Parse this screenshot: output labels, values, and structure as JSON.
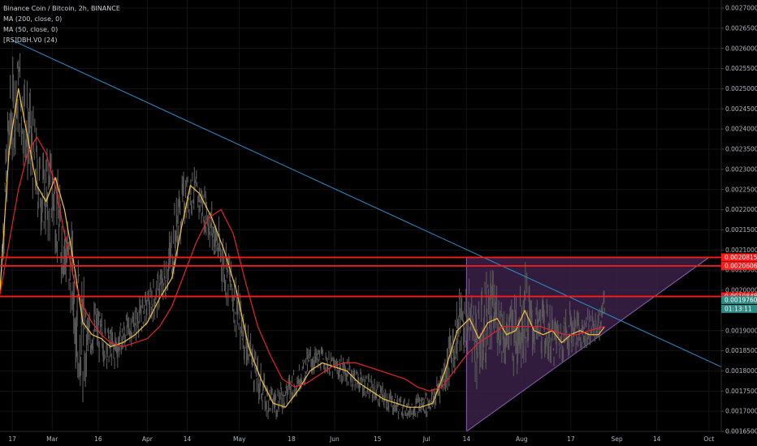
{
  "legend": {
    "line1": "Binance Coin / Bitcoin, 2h, BINANCE",
    "line2": "MA (200, close, 0)",
    "line3": "MA (50, close, 0)",
    "line4": "[RS]DBH.V0 (24)"
  },
  "colors": {
    "background": "#000000",
    "grid": "#141414",
    "candle": "#5a5a5a",
    "ma50": "#f5c23a",
    "ma200": "#e5252b",
    "trendline": "#2f8fd0",
    "level": "#ff1a1a",
    "triangle_fill": "#3a2148",
    "triangle_edge": "#8a5fb0",
    "last_price": "#2e8a84"
  },
  "chart_data": {
    "type": "line",
    "title": "Binance Coin / Bitcoin, 2h, BINANCE",
    "xlabel": "",
    "ylabel": "",
    "x_range": [
      "2020-02-13",
      "2020-10-05"
    ],
    "ylim": [
      0.00165,
      0.00272
    ],
    "y_ticks": [
      "0.0027000",
      "0.0026500",
      "0.0026000",
      "0.0025500",
      "0.0025000",
      "0.0024500",
      "0.0024000",
      "0.0023500",
      "0.0023000",
      "0.0022500",
      "0.0022000",
      "0.0021500",
      "0.0021000",
      "0.0020500",
      "0.0020000",
      "0.0019500",
      "0.0019000",
      "0.0018500",
      "0.0018000",
      "0.0017500",
      "0.0017000",
      "0.0016500"
    ],
    "x_ticks": [
      {
        "label": "17",
        "date": "2020-02-17"
      },
      {
        "label": "Mar",
        "date": "2020-03-01"
      },
      {
        "label": "16",
        "date": "2020-03-16"
      },
      {
        "label": "Apr",
        "date": "2020-04-01"
      },
      {
        "label": "14",
        "date": "2020-04-14"
      },
      {
        "label": "May",
        "date": "2020-05-01"
      },
      {
        "label": "18",
        "date": "2020-05-18"
      },
      {
        "label": "Jun",
        "date": "2020-06-01"
      },
      {
        "label": "15",
        "date": "2020-06-15"
      },
      {
        "label": "Jul",
        "date": "2020-07-01"
      },
      {
        "label": "14",
        "date": "2020-07-14"
      },
      {
        "label": "Aug",
        "date": "2020-08-01"
      },
      {
        "label": "17",
        "date": "2020-08-17"
      },
      {
        "label": "Sep",
        "date": "2020-09-01"
      },
      {
        "label": "14",
        "date": "2020-09-14"
      },
      {
        "label": "Oct",
        "date": "2020-10-01"
      }
    ],
    "price_range": {
      "dates": [
        "2020-02-13",
        "2020-02-16",
        "2020-02-19",
        "2020-02-21",
        "2020-02-24",
        "2020-02-27",
        "2020-03-01",
        "2020-03-04",
        "2020-03-07",
        "2020-03-09",
        "2020-03-11",
        "2020-03-13",
        "2020-03-15",
        "2020-03-18",
        "2020-03-21",
        "2020-03-24",
        "2020-03-27",
        "2020-03-31",
        "2020-04-04",
        "2020-04-07",
        "2020-04-10",
        "2020-04-13",
        "2020-04-16",
        "2020-04-20",
        "2020-04-24",
        "2020-04-28",
        "2020-05-01",
        "2020-05-04",
        "2020-05-07",
        "2020-05-10",
        "2020-05-13",
        "2020-05-16",
        "2020-05-20",
        "2020-05-24",
        "2020-05-28",
        "2020-06-01",
        "2020-06-05",
        "2020-06-09",
        "2020-06-13",
        "2020-06-17",
        "2020-06-21",
        "2020-06-25",
        "2020-06-29",
        "2020-07-03",
        "2020-07-07",
        "2020-07-11",
        "2020-07-15",
        "2020-07-18",
        "2020-07-21",
        "2020-07-24",
        "2020-07-27",
        "2020-07-30",
        "2020-08-02",
        "2020-08-05",
        "2020-08-08",
        "2020-08-11",
        "2020-08-14",
        "2020-08-17",
        "2020-08-20",
        "2020-08-23",
        "2020-08-26",
        "2020-08-28"
      ],
      "high": [
        0.00205,
        0.00256,
        0.00261,
        0.00258,
        0.00245,
        0.00234,
        0.00238,
        0.00225,
        0.00218,
        0.00212,
        0.00205,
        0.00195,
        0.00198,
        0.00194,
        0.00191,
        0.00194,
        0.00196,
        0.002,
        0.00204,
        0.0021,
        0.00223,
        0.0023,
        0.00231,
        0.00226,
        0.00219,
        0.00211,
        0.002,
        0.00193,
        0.00184,
        0.00178,
        0.00177,
        0.00179,
        0.00182,
        0.00187,
        0.00186,
        0.00184,
        0.00184,
        0.00181,
        0.00179,
        0.00177,
        0.00175,
        0.00173,
        0.00175,
        0.00176,
        0.00185,
        0.002,
        0.00203,
        0.00199,
        0.00207,
        0.00203,
        0.00196,
        0.00203,
        0.00208,
        0.00197,
        0.00199,
        0.00196,
        0.00194,
        0.00198,
        0.00194,
        0.00196,
        0.00195,
        0.00201
      ],
      "low": [
        0.00197,
        0.00224,
        0.00238,
        0.00228,
        0.0022,
        0.00211,
        0.00212,
        0.002,
        0.00193,
        0.00178,
        0.00168,
        0.00181,
        0.00183,
        0.00181,
        0.00179,
        0.00183,
        0.00186,
        0.0019,
        0.00193,
        0.00196,
        0.00204,
        0.00216,
        0.00219,
        0.00213,
        0.00203,
        0.00193,
        0.00186,
        0.00178,
        0.00172,
        0.00168,
        0.00168,
        0.0017,
        0.00174,
        0.00178,
        0.0018,
        0.00177,
        0.00176,
        0.00174,
        0.00172,
        0.0017,
        0.00168,
        0.00168,
        0.00168,
        0.00169,
        0.00174,
        0.0018,
        0.00184,
        0.00173,
        0.00181,
        0.00184,
        0.0018,
        0.00178,
        0.00182,
        0.00183,
        0.00183,
        0.00181,
        0.00182,
        0.00184,
        0.00185,
        0.00186,
        0.00187,
        0.0019
      ]
    },
    "series": [
      {
        "name": "MA (50, close, 0)",
        "dates": [
          "2020-02-13",
          "2020-02-16",
          "2020-02-19",
          "2020-02-22",
          "2020-02-25",
          "2020-02-28",
          "2020-03-02",
          "2020-03-05",
          "2020-03-08",
          "2020-03-11",
          "2020-03-14",
          "2020-03-17",
          "2020-03-20",
          "2020-03-24",
          "2020-03-28",
          "2020-04-01",
          "2020-04-05",
          "2020-04-09",
          "2020-04-12",
          "2020-04-15",
          "2020-04-18",
          "2020-04-22",
          "2020-04-26",
          "2020-04-30",
          "2020-05-04",
          "2020-05-08",
          "2020-05-12",
          "2020-05-16",
          "2020-05-20",
          "2020-05-24",
          "2020-05-28",
          "2020-06-01",
          "2020-06-05",
          "2020-06-09",
          "2020-06-13",
          "2020-06-17",
          "2020-06-21",
          "2020-06-25",
          "2020-06-29",
          "2020-07-03",
          "2020-07-07",
          "2020-07-11",
          "2020-07-15",
          "2020-07-18",
          "2020-07-21",
          "2020-07-24",
          "2020-07-27",
          "2020-07-30",
          "2020-08-02",
          "2020-08-05",
          "2020-08-08",
          "2020-08-11",
          "2020-08-14",
          "2020-08-17",
          "2020-08-20",
          "2020-08-23",
          "2020-08-26",
          "2020-08-28"
        ],
        "values": [
          0.002,
          0.00235,
          0.0025,
          0.00238,
          0.00226,
          0.00222,
          0.00228,
          0.0022,
          0.00207,
          0.00192,
          0.00189,
          0.00188,
          0.00186,
          0.00187,
          0.00189,
          0.00192,
          0.00198,
          0.00203,
          0.00215,
          0.00226,
          0.00224,
          0.00218,
          0.0021,
          0.002,
          0.00186,
          0.00178,
          0.00172,
          0.00171,
          0.00175,
          0.0018,
          0.00182,
          0.00181,
          0.0018,
          0.00177,
          0.00175,
          0.00173,
          0.00172,
          0.00171,
          0.00171,
          0.00172,
          0.0018,
          0.0019,
          0.00193,
          0.00188,
          0.00192,
          0.00193,
          0.00189,
          0.0019,
          0.00195,
          0.0019,
          0.00189,
          0.0019,
          0.00187,
          0.00189,
          0.0019,
          0.00189,
          0.00189,
          0.00191
        ]
      },
      {
        "name": "MA (200, close, 0)",
        "dates": [
          "2020-02-13",
          "2020-02-16",
          "2020-02-19",
          "2020-02-22",
          "2020-02-25",
          "2020-02-28",
          "2020-03-02",
          "2020-03-05",
          "2020-03-08",
          "2020-03-11",
          "2020-03-14",
          "2020-03-17",
          "2020-03-20",
          "2020-03-24",
          "2020-03-28",
          "2020-04-01",
          "2020-04-05",
          "2020-04-09",
          "2020-04-13",
          "2020-04-17",
          "2020-04-21",
          "2020-04-25",
          "2020-04-29",
          "2020-05-03",
          "2020-05-07",
          "2020-05-11",
          "2020-05-15",
          "2020-05-19",
          "2020-05-23",
          "2020-05-27",
          "2020-05-31",
          "2020-06-04",
          "2020-06-08",
          "2020-06-12",
          "2020-06-16",
          "2020-06-20",
          "2020-06-24",
          "2020-06-28",
          "2020-07-02",
          "2020-07-06",
          "2020-07-10",
          "2020-07-14",
          "2020-07-18",
          "2020-07-22",
          "2020-07-26",
          "2020-07-30",
          "2020-08-03",
          "2020-08-07",
          "2020-08-11",
          "2020-08-15",
          "2020-08-19",
          "2020-08-23",
          "2020-08-28"
        ],
        "values": [
          0.00199,
          0.00212,
          0.00225,
          0.00234,
          0.00238,
          0.00234,
          0.00226,
          0.00214,
          0.00203,
          0.00196,
          0.00192,
          0.00189,
          0.00187,
          0.00186,
          0.00187,
          0.00188,
          0.00191,
          0.00196,
          0.00204,
          0.00212,
          0.00218,
          0.0022,
          0.00214,
          0.00202,
          0.00191,
          0.00184,
          0.00178,
          0.00176,
          0.00177,
          0.00179,
          0.00181,
          0.00182,
          0.00182,
          0.00181,
          0.0018,
          0.00179,
          0.00178,
          0.00176,
          0.00175,
          0.00176,
          0.0018,
          0.00184,
          0.00187,
          0.00189,
          0.00191,
          0.00191,
          0.00191,
          0.00191,
          0.0019,
          0.00189,
          0.00189,
          0.0019,
          0.00191
        ]
      }
    ],
    "trendline": {
      "start": {
        "date": "2020-02-17",
        "value": 0.00262
      },
      "end": {
        "date": "2020-10-05",
        "value": 0.00181
      }
    },
    "levels": [
      {
        "label": "0.0020815",
        "value": 0.0020815
      },
      {
        "label": "0.0020606",
        "value": 0.0020606
      },
      {
        "label": "0.0019848",
        "value": 0.0019848
      }
    ],
    "triangle": [
      {
        "date": "2020-07-14",
        "value": 0.0020815
      },
      {
        "date": "2020-10-01",
        "value": 0.0020815
      },
      {
        "date": "2020-07-14",
        "value": 0.00165
      }
    ],
    "last_price": {
      "label": "0.0019760",
      "value": 0.001976
    },
    "countdown": {
      "label": "01:13:11"
    }
  }
}
